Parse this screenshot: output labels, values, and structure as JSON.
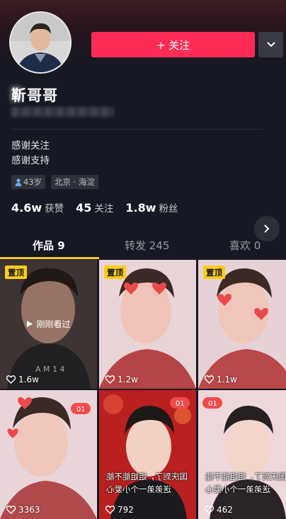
{
  "profile": {
    "follow_label": "+ 关注",
    "username": "靳哥哥",
    "bio": [
      "感谢关注",
      "感谢支持"
    ],
    "tags": [
      "43岁",
      "北京 · 海淀"
    ],
    "stats": [
      {
        "value": "4.6w",
        "label": "获赞"
      },
      {
        "value": "45",
        "label": "关注"
      },
      {
        "value": "1.8w",
        "label": "粉丝"
      }
    ]
  },
  "tabs": [
    {
      "label": "作品 9",
      "active": true
    },
    {
      "label": "转发 245",
      "active": false
    },
    {
      "label": "喜欢 0",
      "active": false
    }
  ],
  "videos": [
    {
      "pinned": true,
      "pin_label": "置顶",
      "likes": "1.6w",
      "just_watched": "刚刚看过"
    },
    {
      "pinned": true,
      "pin_label": "置顶",
      "likes": "1.2w"
    },
    {
      "pinned": true,
      "pin_label": "置顶",
      "likes": "1.1w"
    },
    {
      "pinned": false,
      "likes": "3363"
    },
    {
      "pinned": false,
      "likes": "792",
      "overlay": [
        "国庆到了，姐姐能不能",
        "送弟弟一个小爱心"
      ]
    },
    {
      "pinned": false,
      "likes": "462",
      "overlay": [
        "国庆到了，姐姐能不能",
        "送弟弟一个小爱心"
      ]
    }
  ],
  "icons": {
    "chevron_down": "chevron-down-icon",
    "next": "chevron-right-icon",
    "heart": "heart-icon",
    "person": "person-icon",
    "play": "play-icon"
  },
  "colors": {
    "accent": "#fe2c55",
    "tab_indicator": "#face15",
    "pin": "#face15",
    "background": "#161823"
  }
}
